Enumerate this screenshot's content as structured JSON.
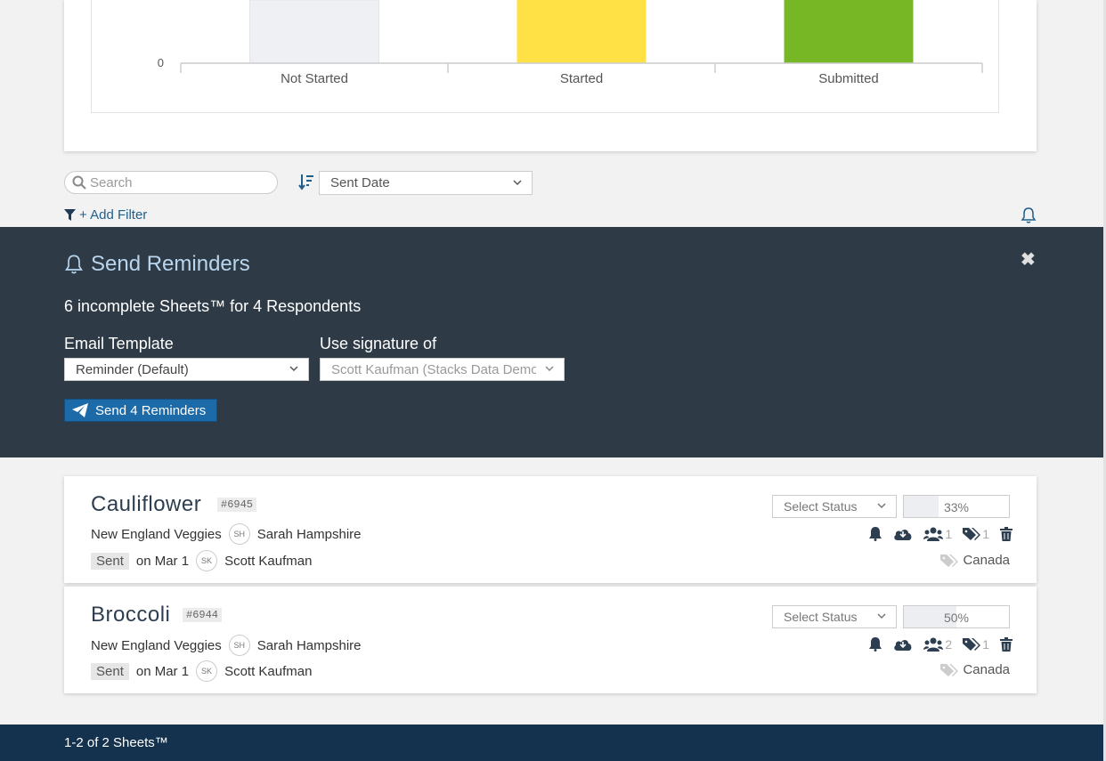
{
  "chart_data": {
    "type": "bar",
    "categories": [
      "Not Started",
      "Started",
      "Submitted"
    ],
    "colors": [
      "#eef0f3",
      "#ffe045",
      "#77b726"
    ],
    "y_tick_label": "0"
  },
  "toolbar": {
    "search_placeholder": "Search",
    "sort_label": "Sent Date",
    "add_filter_label": "+ Add Filter"
  },
  "reminders": {
    "title": "Send Reminders",
    "summary": "6 incomplete Sheets™ for 4 Respondents",
    "email_template_label": "Email Template",
    "email_template_value": "Reminder (Default)",
    "signature_label": "Use signature of",
    "signature_value": "Scott Kaufman (Stacks Data Demo",
    "send_button_label": "Send 4 Reminders",
    "close_symbol": "✖"
  },
  "sheets": [
    {
      "name": "Cauliflower",
      "id": "#6945",
      "organization": "New England Veggies",
      "respondent_initials": "SH",
      "respondent": "Sarah Hampshire",
      "status_badge": "Sent",
      "sent_on": "on Mar 1",
      "sender_initials": "SK",
      "sender": "Scott Kaufman",
      "status_placeholder": "Select Status",
      "progress_label": "33%",
      "progress_fraction": 0.33,
      "people_count": "1",
      "tag_count": "1",
      "tag": "Canada"
    },
    {
      "name": "Broccoli",
      "id": "#6944",
      "organization": "New England Veggies",
      "respondent_initials": "SH",
      "respondent": "Sarah Hampshire",
      "status_badge": "Sent",
      "sent_on": "on Mar 1",
      "sender_initials": "SK",
      "sender": "Scott Kaufman",
      "status_placeholder": "Select Status",
      "progress_label": "50%",
      "progress_fraction": 0.5,
      "people_count": "2",
      "tag_count": "1",
      "tag": "Canada"
    }
  ],
  "footer": {
    "pagination": "1-2 of 2 Sheets™"
  }
}
